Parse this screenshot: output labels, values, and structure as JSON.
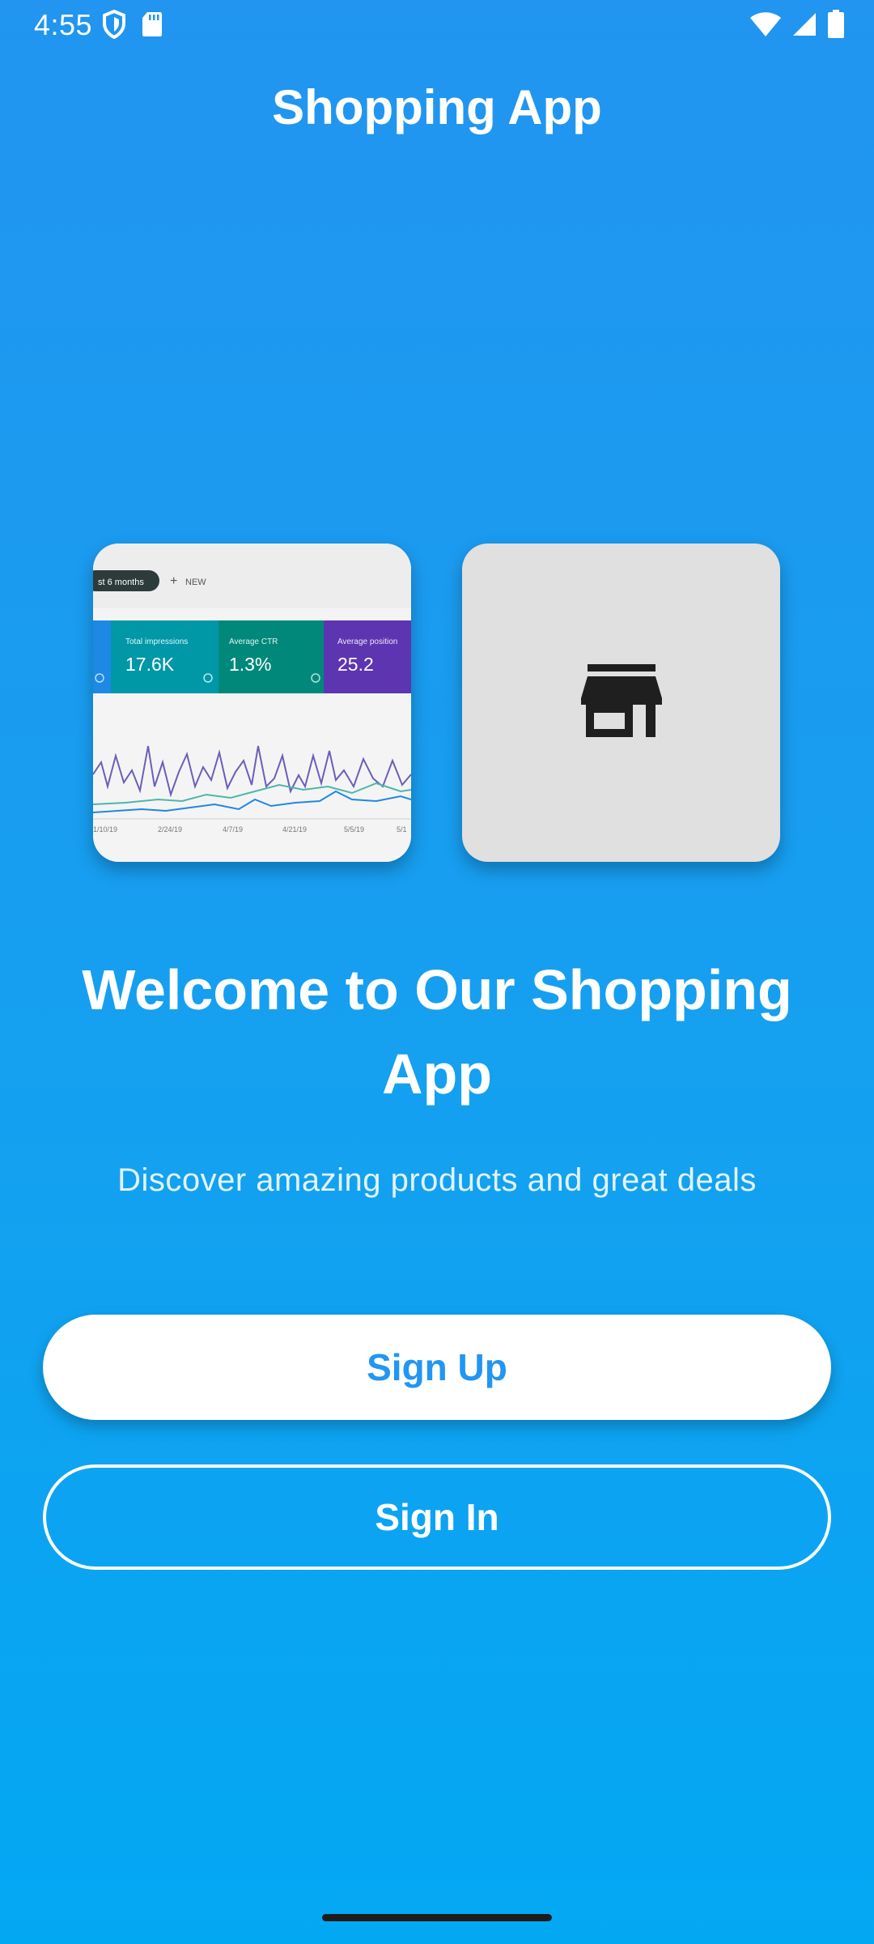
{
  "status_bar": {
    "time": "4:55",
    "left_icons": [
      "shield-icon",
      "sd-card-icon"
    ],
    "right_icons": [
      "wifi-icon",
      "cellular-signal-icon",
      "battery-icon"
    ]
  },
  "app_bar": {
    "title": "Shopping App"
  },
  "analytics_image": {
    "chip_label": "st 6 months",
    "new_label": "NEW",
    "metrics": [
      {
        "label": "Total impressions",
        "value": "17.6K",
        "color": "#0097a7"
      },
      {
        "label": "Average CTR",
        "value": "1.3%",
        "color": "#00897b"
      },
      {
        "label": "Average position",
        "value": "25.2",
        "color": "#5e35b1"
      }
    ],
    "x_ticks": [
      "1/10/19",
      "2/24/19",
      "4/7/19",
      "4/21/19",
      "5/5/19",
      "5/1"
    ]
  },
  "store_card": {
    "icon": "store-icon"
  },
  "welcome": {
    "title": "Welcome to Our Shopping App",
    "subtitle": "Discover amazing products and great deals"
  },
  "buttons": {
    "sign_up": "Sign Up",
    "sign_in": "Sign In"
  },
  "colors": {
    "background_top": "#2195f0",
    "background_bottom": "#03a8f3",
    "primary": "#2196f3",
    "store_card_bg": "#e0e0e0"
  }
}
